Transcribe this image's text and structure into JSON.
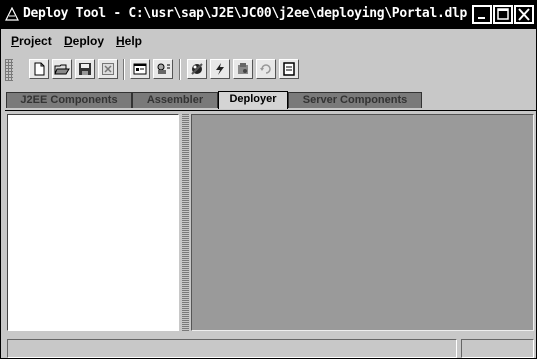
{
  "window": {
    "title": "Deploy Tool - C:\\usr\\sap\\J2E\\JC00\\j2ee\\deploying\\Portal.dlp"
  },
  "title_controls": [
    {
      "name": "minimize-button",
      "icon": "minimize-icon"
    },
    {
      "name": "maximize-button",
      "icon": "maximize-icon"
    },
    {
      "name": "close-button",
      "icon": "close-icon"
    }
  ],
  "menubar": {
    "project": {
      "mn": "P",
      "rest": "roject"
    },
    "deploy": {
      "mn": "D",
      "rest": "eploy"
    },
    "help": {
      "mn": "H",
      "rest": "elp"
    }
  },
  "toolbar": {
    "buttons": [
      "new-file-icon",
      "open-folder-icon",
      "save-icon",
      "close-file-icon",
      "properties-icon",
      "connect-icon",
      "deploy-icon",
      "lightning-icon",
      "server-icon",
      "refresh-icon",
      "log-icon"
    ]
  },
  "tabs": [
    {
      "label": "J2EE Components",
      "active": false
    },
    {
      "label": "Assembler",
      "active": false
    },
    {
      "label": "Deployer",
      "active": true
    },
    {
      "label": "Server Components",
      "active": false
    }
  ],
  "statusbar": {
    "message": "",
    "side": ""
  },
  "colors": {
    "titlebar": "#000000",
    "window_bg": "#c8c8c8",
    "right_pane": "#9a9a9a",
    "left_pane": "#ffffff"
  }
}
